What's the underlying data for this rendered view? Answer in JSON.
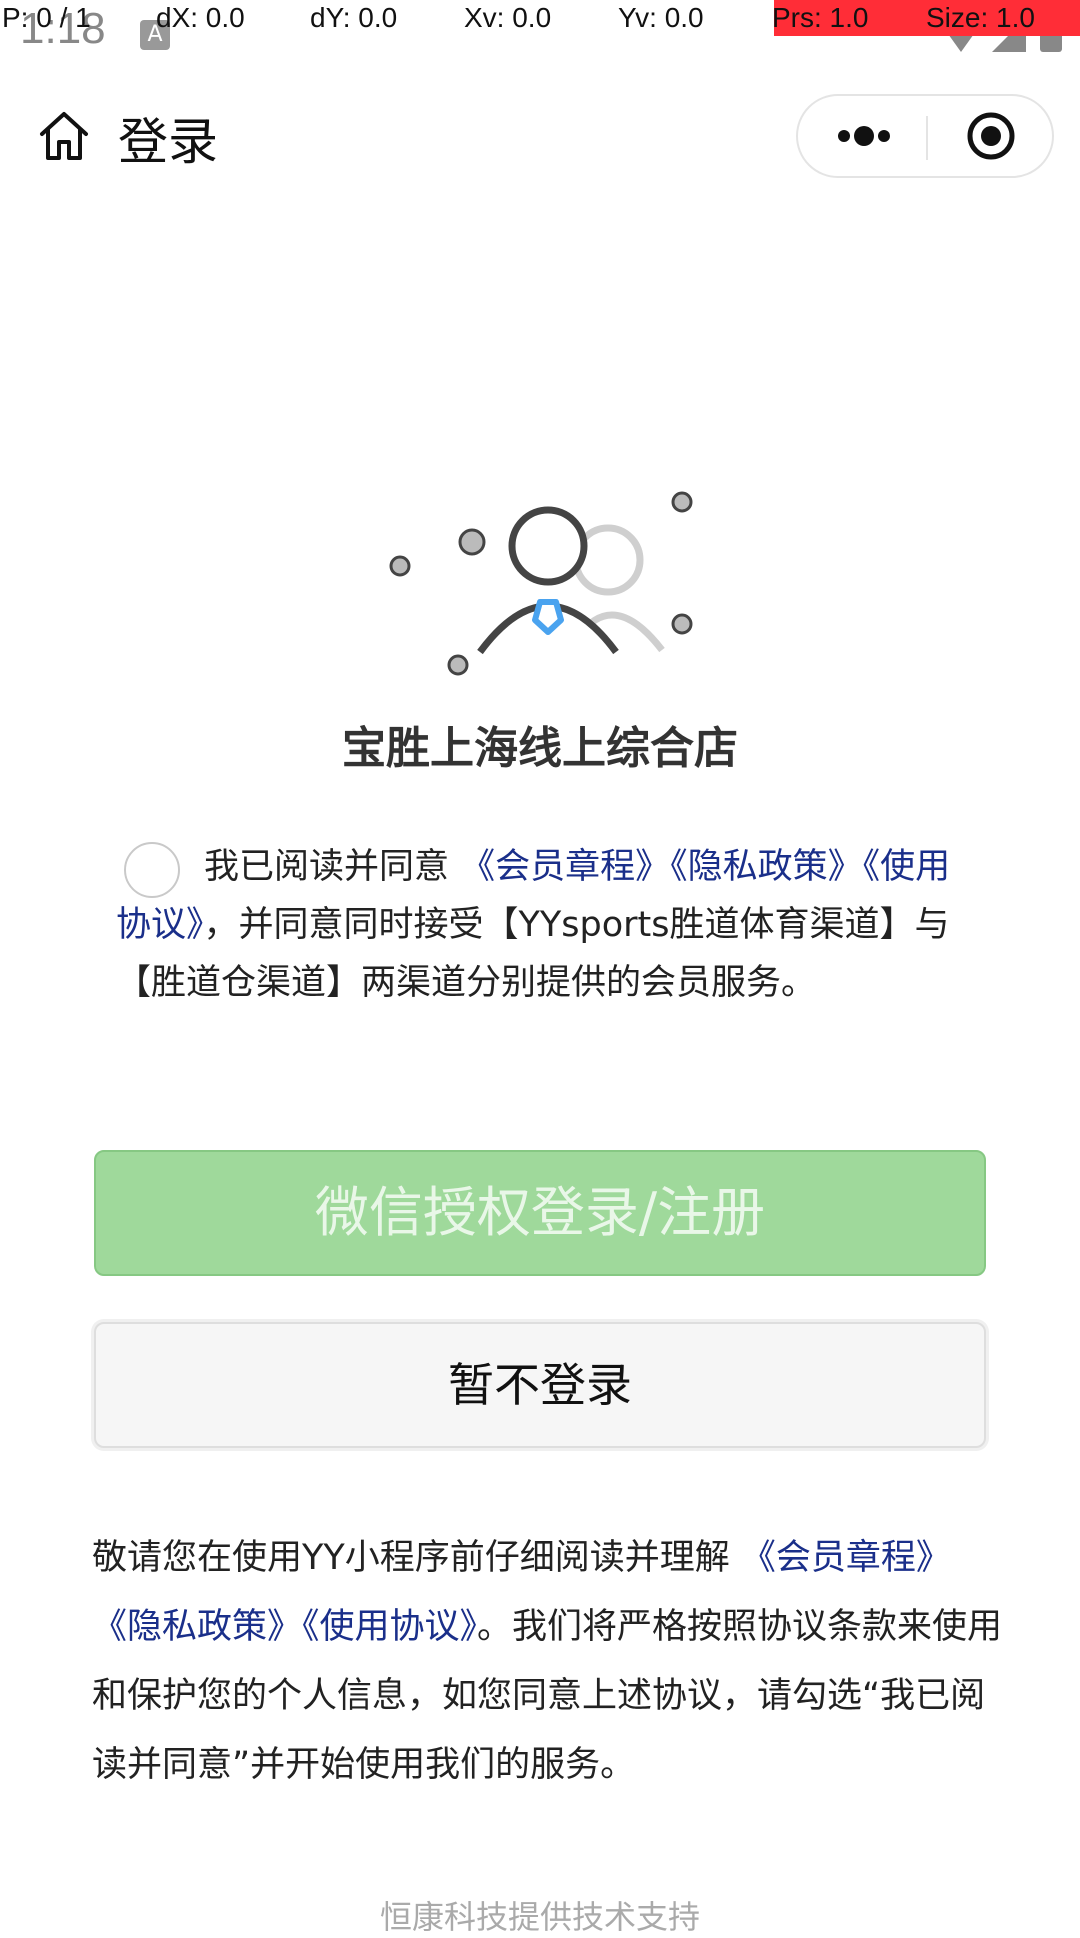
{
  "debug": {
    "p": "P: 0 / 1",
    "dx": "dX: 0.0",
    "dy": "dY: 0.0",
    "xv": "Xv: 0.0",
    "yv": "Yv: 0.0",
    "prs": "Prs: 1.0",
    "size": "Size: 1.0",
    "highlight_color": "#ff2d37"
  },
  "status": {
    "time": "1:18"
  },
  "nav": {
    "title": "登录",
    "icons": [
      "home-icon",
      "more-icon",
      "close-target-icon"
    ]
  },
  "store": {
    "name": "宝胜上海线上综合店"
  },
  "agreement": {
    "prefix": "我已阅读并同意 ",
    "link1": "《会员章程》",
    "link2": "《隐私政策》",
    "link3": "《使用协议》",
    "suffix": "，并同意同时接受【YYsports胜道体育渠道】与【胜道仓渠道】两渠道分别提供的会员服务。",
    "checked": false
  },
  "buttons": {
    "wechat_login": "微信授权登录/注册",
    "skip_login": "暂不登录"
  },
  "notice": {
    "prefix": "敬请您在使用YY小程序前仔细阅读并理解 ",
    "link1": "《会员章程》",
    "link2": "《隐私政策》",
    "link3": "《使用协议》",
    "suffix": "。我们将严格按照协议条款来使用和保护您的个人信息，如您同意上述协议，请勾选“我已阅读并同意”并开始使用我们的服务。"
  },
  "footer": {
    "support": "恒康科技提供技术支持"
  },
  "colors": {
    "link": "#1a2f8a",
    "wechat_button": "#9fd99b",
    "accent_tie": "#4aa3ef"
  }
}
